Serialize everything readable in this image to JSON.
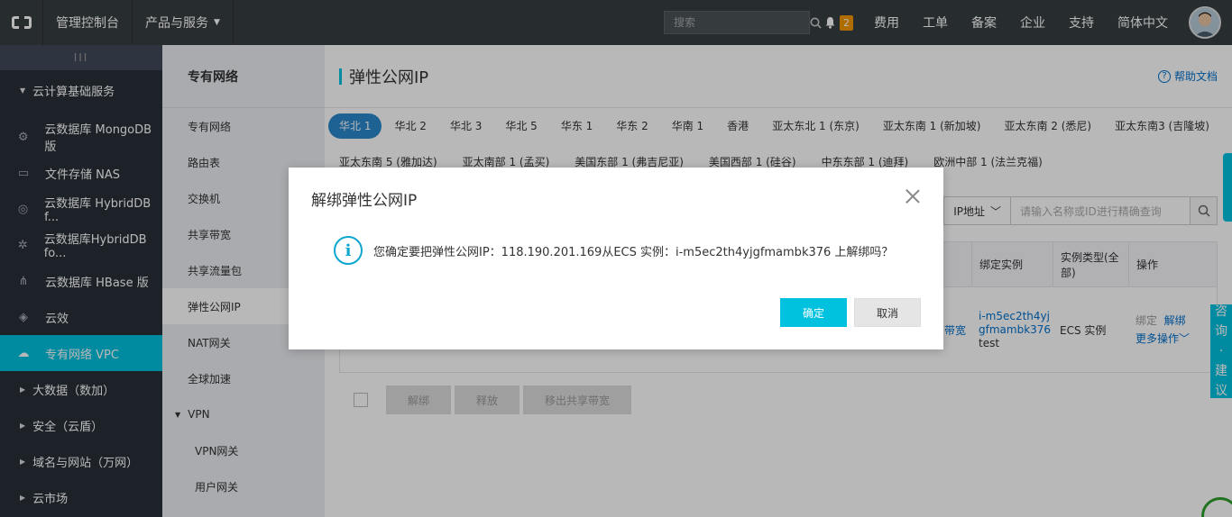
{
  "topbar": {
    "console_label": "管理控制台",
    "products_label": "产品与服务",
    "search_placeholder": "搜索",
    "notification_count": "2",
    "links": [
      "费用",
      "工单",
      "备案",
      "企业",
      "支持",
      "简体中文"
    ]
  },
  "sidebar": {
    "handle": "III",
    "group_label": "云计算基础服务",
    "items": [
      {
        "label": "云数据库 MongoDB 版",
        "icon": "mongodb-icon"
      },
      {
        "label": "文件存储 NAS",
        "icon": "nas-icon"
      },
      {
        "label": "云数据库 HybridDB f...",
        "icon": "hybriddb-icon"
      },
      {
        "label": "云数据库HybridDB fo...",
        "icon": "hybriddb-mysql-icon"
      },
      {
        "label": "云数据库 HBase 版",
        "icon": "hbase-icon"
      },
      {
        "label": "云效",
        "icon": "yunxiao-icon"
      },
      {
        "label": "专有网络 VPC",
        "icon": "vpc-cloud-icon"
      }
    ],
    "sub_groups": [
      "大数据（数加）",
      "安全（云盾）",
      "域名与网站（万网）",
      "云市场"
    ]
  },
  "subnav": {
    "title": "专有网络",
    "items": [
      "专有网络",
      "路由表",
      "交换机",
      "共享带宽",
      "共享流量包",
      "弹性公网IP",
      "NAT网关",
      "全球加速"
    ],
    "vpn_label": "VPN",
    "vpn_children": [
      "VPN网关",
      "用户网关"
    ]
  },
  "main": {
    "title": "弹性公网IP",
    "help_label": "帮助文档",
    "regions_row1": [
      "华北 1",
      "华北 2",
      "华北 3",
      "华北 5",
      "华东 1",
      "华东 2",
      "华南 1",
      "香港",
      "亚太东北 1 (东京)",
      "亚太东南 1 (新加坡)",
      "亚太东南 2 (悉尼)",
      "亚太东南3 (吉隆坡)"
    ],
    "regions_row2": [
      "亚太东南 5 (雅加达)",
      "亚太南部 1 (孟买)",
      "美国东部 1 (弗吉尼亚)",
      "美国西部 1 (硅谷)",
      "中东东部 1 (迪拜)",
      "欧洲中部 1 (法兰克福)"
    ],
    "filter_select": "IP地址",
    "filter_placeholder": "请输入名称或ID进行精确查询",
    "table_headers": [
      "绑定实例",
      "实例类型(全部)",
      "操作"
    ],
    "row": {
      "partial_link": "带宽",
      "instance_link": "i-m5ec2th4yjgfmambk376",
      "instance_name": "test",
      "instance_type": "ECS 实例",
      "bind_label": "绑定",
      "unbind_label": "解绑",
      "more_label": "更多操作"
    },
    "bottom_buttons": [
      "解绑",
      "释放",
      "移出共享带宽"
    ],
    "consult_label": [
      "咨",
      "询",
      "·",
      "建",
      "议"
    ]
  },
  "dialog": {
    "title": "解绑弹性公网IP",
    "message": "您确定要把弹性公网IP：118.190.201.169从ECS 实例：i-m5ec2th4yjgfmambk376 上解绑吗？",
    "ok_label": "确定",
    "cancel_label": "取消"
  }
}
